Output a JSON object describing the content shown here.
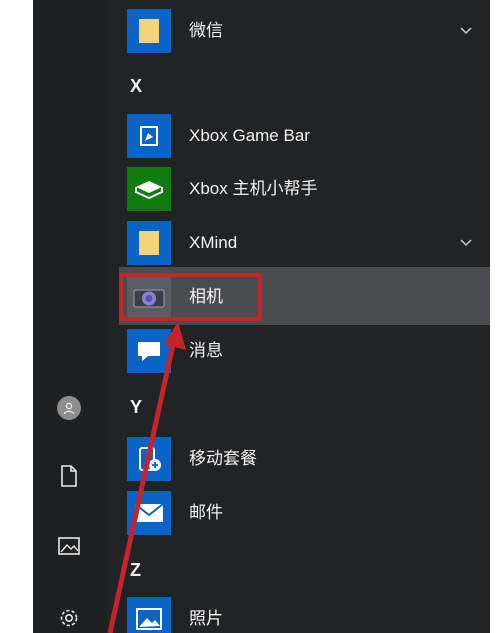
{
  "theme": {
    "menu_bg": "#222325",
    "tile_blue": "#0a64c8",
    "xbox_green": "#107c10",
    "hover_bg": "#4b4c4f",
    "annotation_red": "#c5242a"
  },
  "sidebar": {
    "items": [
      {
        "icon": "user-avatar-icon"
      },
      {
        "icon": "document-icon"
      },
      {
        "icon": "pictures-icon"
      },
      {
        "icon": "settings-gear-icon"
      }
    ]
  },
  "app_list": {
    "wechat": {
      "label": "微信",
      "icon": "folder-icon"
    },
    "letter_x": "X",
    "xbox_game_bar": {
      "label": "Xbox Game Bar",
      "icon": "xbox-game-bar-icon"
    },
    "xbox_companion": {
      "label": "Xbox 主机小帮手",
      "icon": "xbox-console-icon"
    },
    "xmind": {
      "label": "XMind",
      "icon": "folder-icon"
    },
    "camera": {
      "label": "相机",
      "icon": "camera-icon"
    },
    "messages": {
      "label": "消息",
      "icon": "message-icon"
    },
    "letter_y": "Y",
    "mobile_plans": {
      "label": "移动套餐",
      "icon": "mobile-plans-icon"
    },
    "mail": {
      "label": "邮件",
      "icon": "mail-icon"
    },
    "letter_z": "Z",
    "photos": {
      "label": "照片",
      "icon": "photos-icon"
    }
  },
  "annotation": {
    "type": "arrow-pointing-to-camera"
  }
}
